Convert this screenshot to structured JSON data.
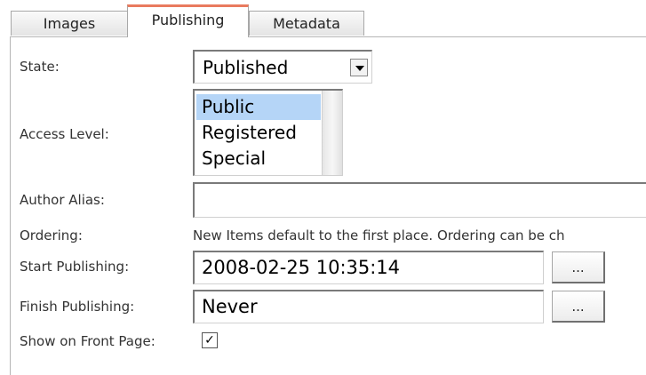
{
  "tabs": [
    {
      "label": "Images"
    },
    {
      "label": "Publishing"
    },
    {
      "label": "Metadata"
    }
  ],
  "form": {
    "state": {
      "label": "State:",
      "value": "Published"
    },
    "access_level": {
      "label": "Access Level:",
      "options": [
        "Public",
        "Registered",
        "Special"
      ],
      "selected": "Public"
    },
    "author_alias": {
      "label": "Author Alias:",
      "value": ""
    },
    "ordering": {
      "label": "Ordering:",
      "note": "New Items default to the first place. Ordering can be ch"
    },
    "start_publishing": {
      "label": "Start Publishing:",
      "value": "2008-02-25 10:35:14",
      "button": "..."
    },
    "finish_publishing": {
      "label": "Finish Publishing:",
      "value": "Never",
      "button": "..."
    },
    "front_page": {
      "label": "Show on Front Page:",
      "checked": "✓"
    }
  },
  "colors": {
    "active_tab_accent": "#e97a5e",
    "selection": "#b5d5f7"
  }
}
